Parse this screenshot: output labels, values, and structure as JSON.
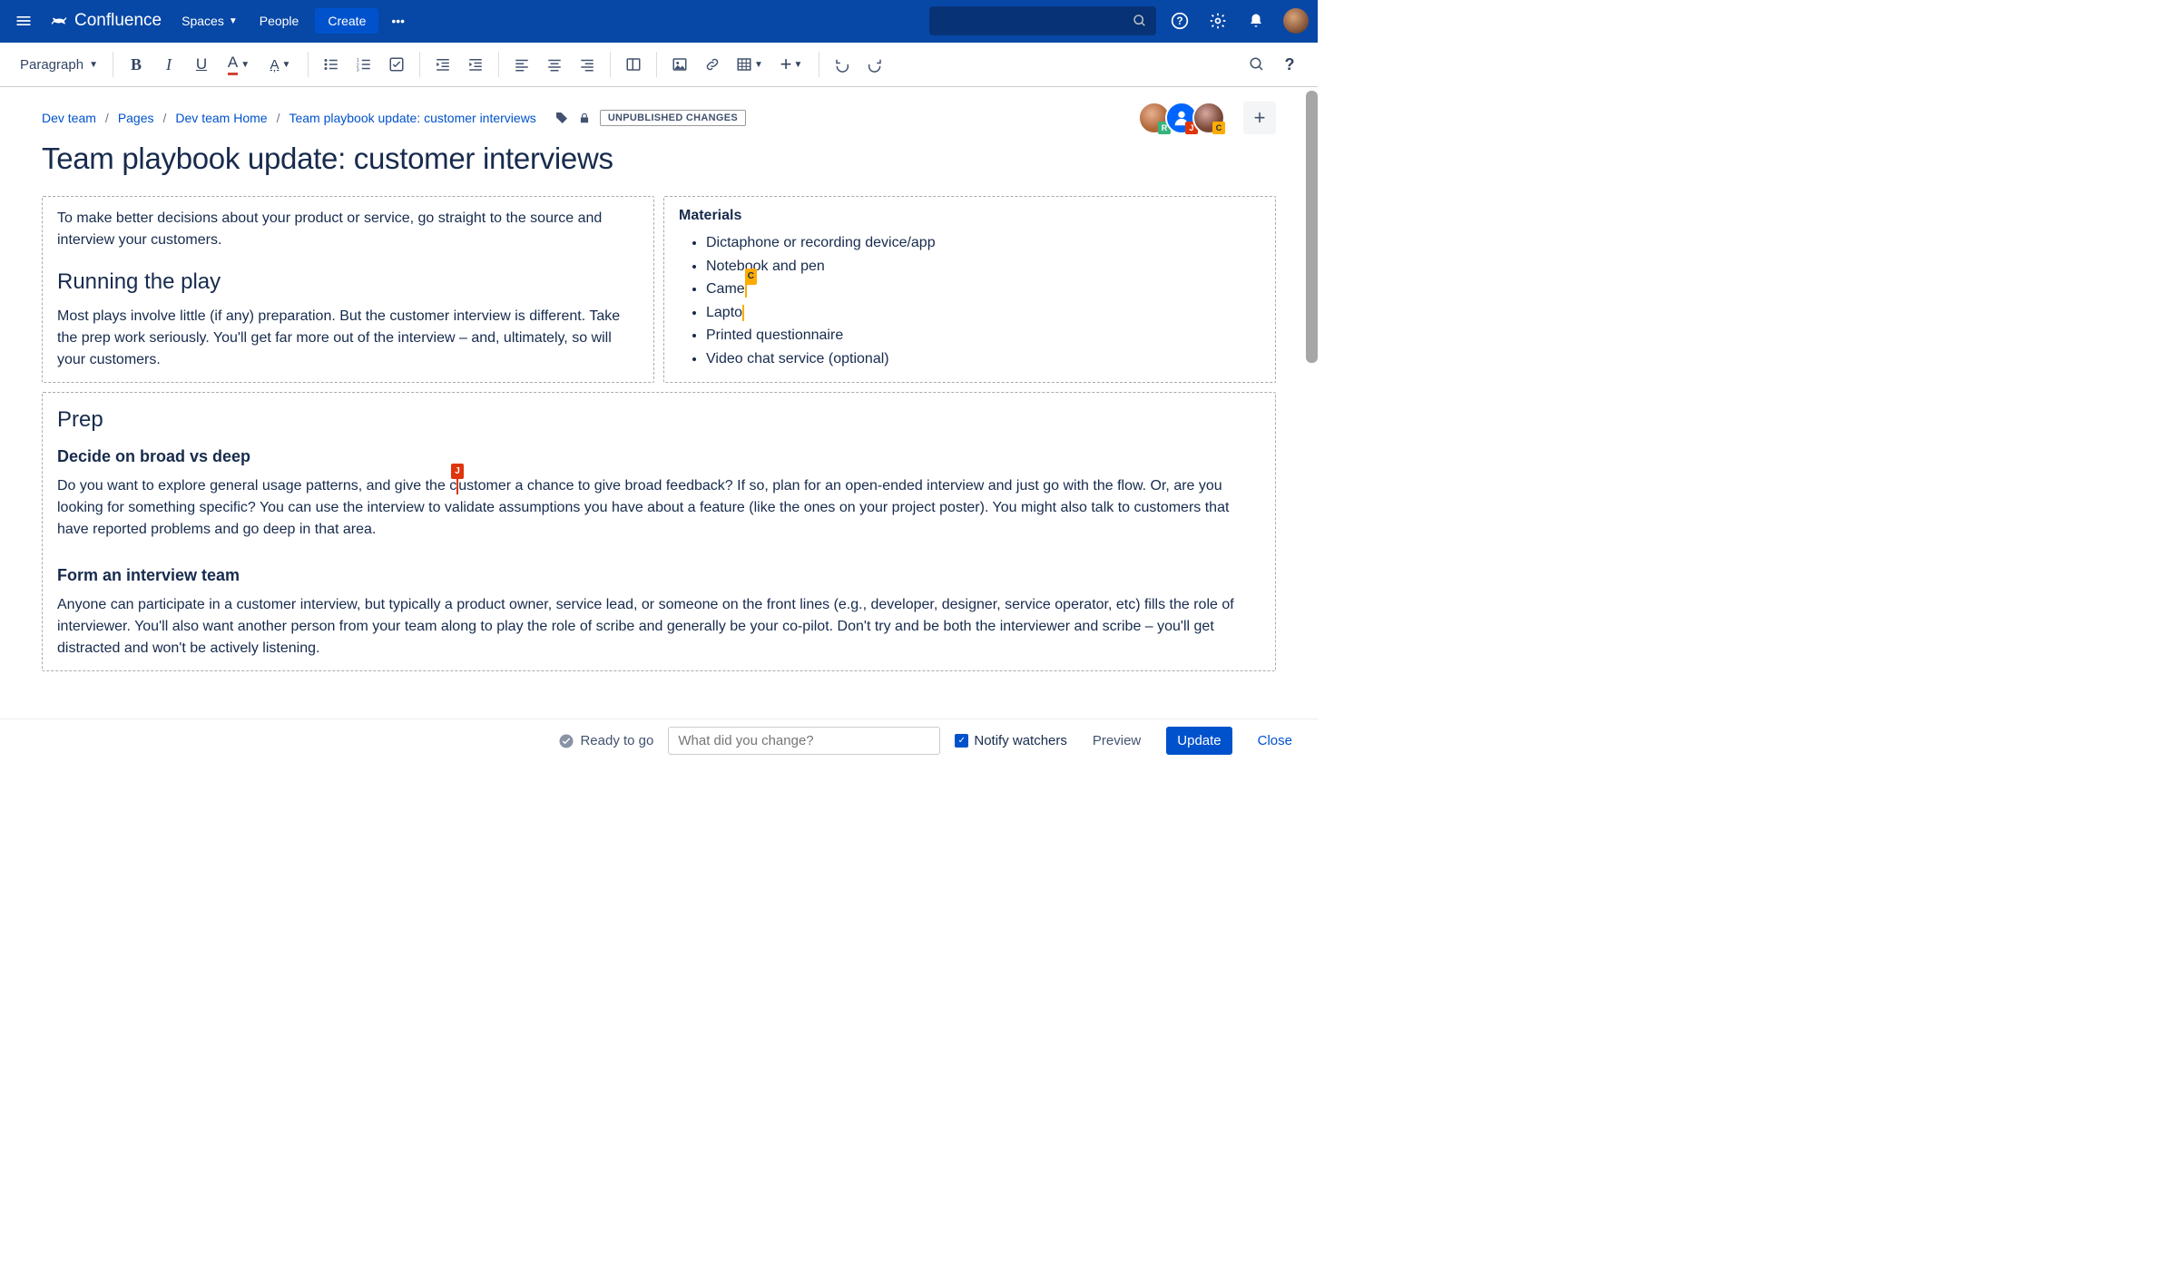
{
  "topnav": {
    "brand": "Confluence",
    "spaces": "Spaces",
    "people": "People",
    "create": "Create"
  },
  "toolbar": {
    "style_select": "Paragraph"
  },
  "breadcrumb": {
    "items": [
      "Dev team",
      "Pages",
      "Dev team Home",
      "Team playbook update: customer interviews"
    ],
    "badge": "UNPUBLISHED CHANGES"
  },
  "collaborators": [
    {
      "badge": "R",
      "color": "g"
    },
    {
      "badge": "J",
      "color": "r"
    },
    {
      "badge": "C",
      "color": "y"
    }
  ],
  "page": {
    "title": "Team playbook update: customer interviews",
    "intro": "To make better decisions about your product or service, go straight to the source and interview your customers.",
    "running_h": "Running the play",
    "running_p": "Most plays involve little (if any) preparation. But the customer interview is different. Take the prep work seriously. You'll get far more out of the interview – and, ultimately, so will your customers.",
    "materials_h": "Materials",
    "materials": [
      "Dictaphone or recording device/app",
      "Notebook and pen",
      "Came",
      "Lapto",
      "Printed questionnaire",
      "Video chat service (optional)"
    ],
    "cursor_c_tag": "C",
    "prep_h": "Prep",
    "decide_h": "Decide on broad vs deep",
    "cursor_j_tag": "J",
    "decide_p_before": "Do you want to explore general usage patterns, and give the c",
    "decide_p_after": "ustomer a chance to give broad feedback? If so, plan for an open-ended interview and just go with the flow. Or, are you looking for something specific? You can use the interview to validate assumptions you have about a feature (like the ones on your project poster). You might also talk to customers that have reported problems and go deep in that area.",
    "form_h": "Form an interview team",
    "form_p": "Anyone can participate in a customer interview, but typically a product owner, service lead, or someone on the front lines (e.g., developer, designer, service operator, etc) fills the role of interviewer. You'll also want another person from your team along to play the role of scribe and generally be your co-pilot. Don't try and be both the interviewer and scribe – you'll get distracted and won't be actively listening."
  },
  "footer": {
    "ready": "Ready to go",
    "change_placeholder": "What did you change?",
    "notify": "Notify watchers",
    "preview": "Preview",
    "update": "Update",
    "close": "Close"
  }
}
